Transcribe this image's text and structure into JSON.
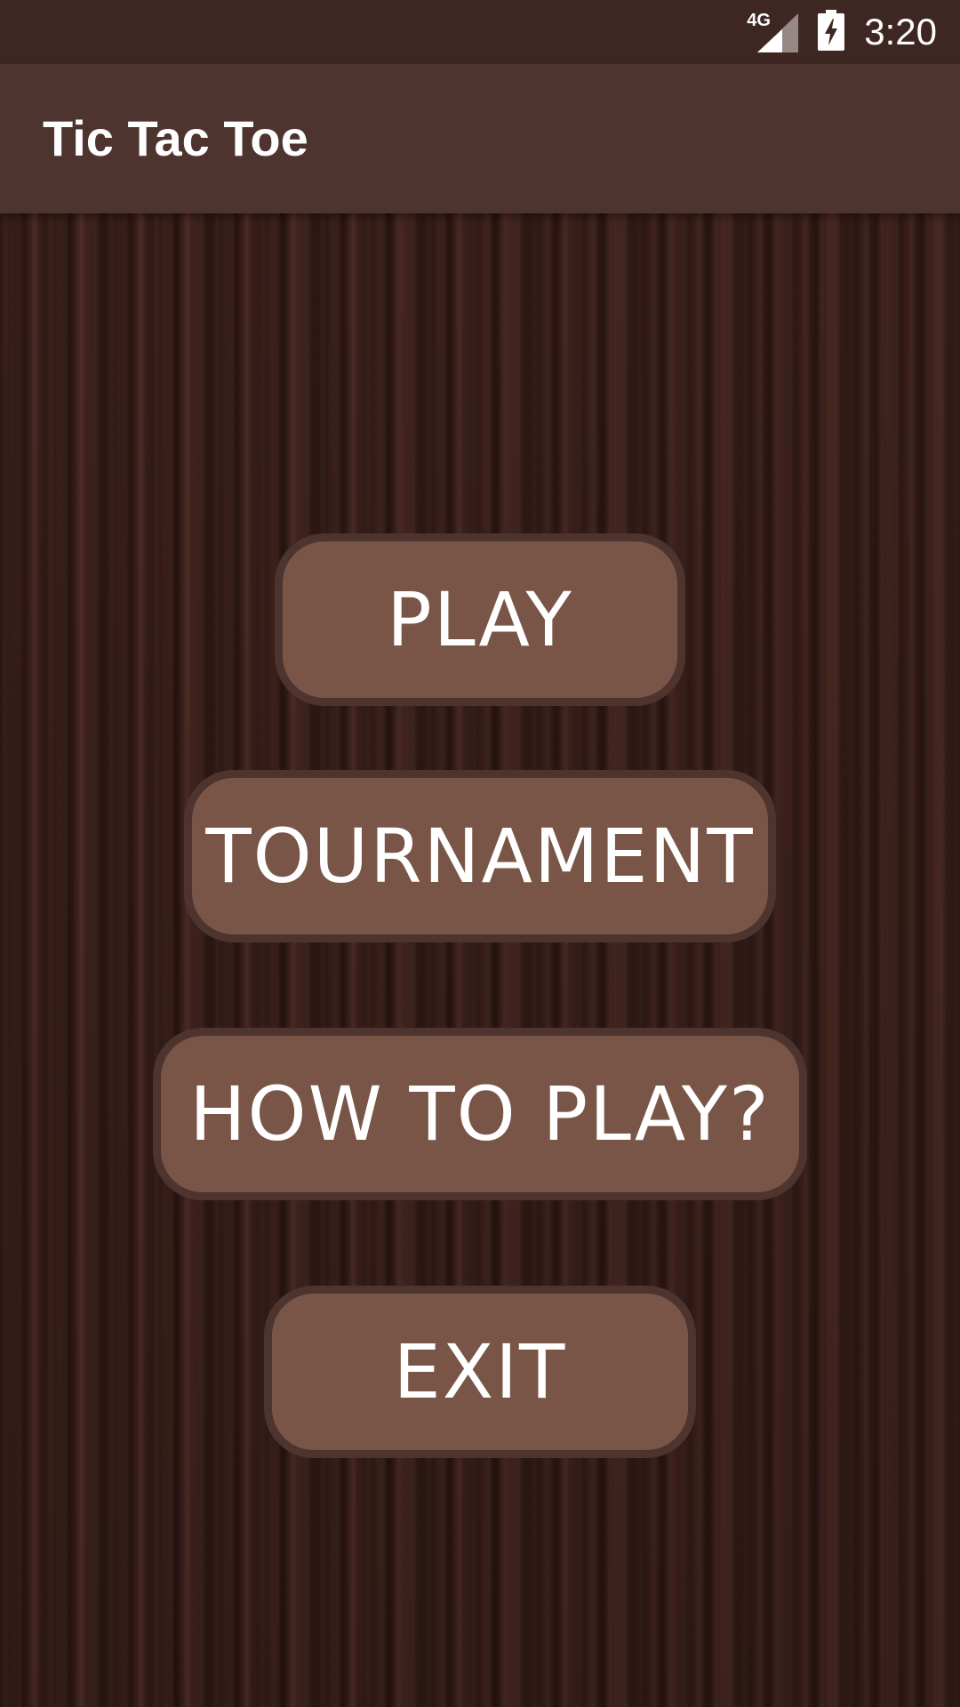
{
  "status_bar": {
    "network_label": "4G",
    "time": "3:20",
    "icons": [
      "signal-icon",
      "battery-charging-icon"
    ]
  },
  "app_bar": {
    "title": "Tic Tac Toe"
  },
  "menu": {
    "play": "PLAY",
    "tournament": "TOURNAMENT",
    "how_to_play": "HOW TO PLAY?",
    "exit": "EXIT"
  },
  "colors": {
    "status_bar": "#3e2723",
    "app_bar": "#4e342e",
    "button_fill": "#795548",
    "button_border": "#4e342e",
    "text": "#ffffff"
  }
}
